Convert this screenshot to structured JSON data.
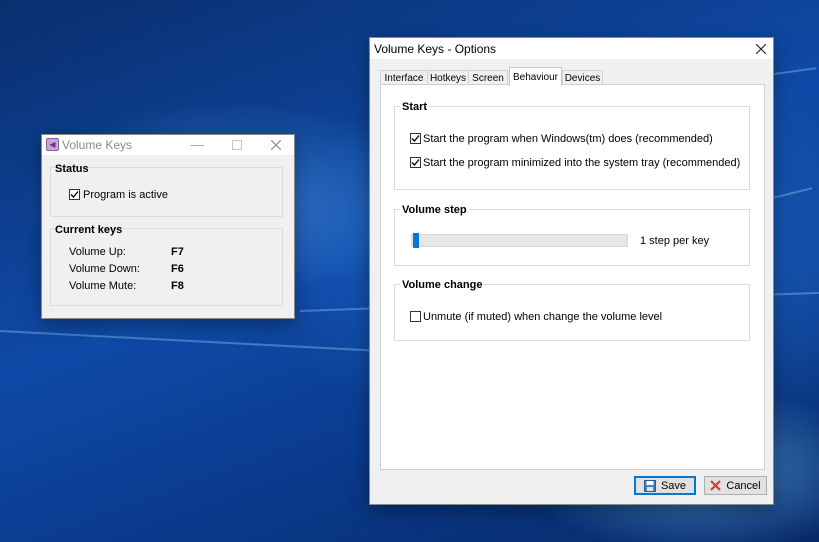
{
  "small_window": {
    "title": "Volume Keys",
    "status_group": "Status",
    "program_active_label": "Program is active",
    "program_active_checked": true,
    "keys_group": "Current keys",
    "keys": [
      {
        "label": "Volume Up:",
        "key": "F7"
      },
      {
        "label": "Volume Down:",
        "key": "F6"
      },
      {
        "label": "Volume Mute:",
        "key": "F8"
      }
    ]
  },
  "options_window": {
    "title": "Volume Keys - Options",
    "tabs": [
      "Interface",
      "Hotkeys",
      "Screen",
      "Behaviour",
      "Devices"
    ],
    "active_tab": "Behaviour",
    "start_group": "Start",
    "start_windows_label": "Start the program when Windows(tm) does (recommended)",
    "start_windows_checked": true,
    "start_minimized_label": "Start the program minimized into the system tray (recommended)",
    "start_minimized_checked": true,
    "step_group": "Volume step",
    "step_label": "1 step per key",
    "step_value_fraction": 0.0,
    "change_group": "Volume change",
    "unmute_label": "Unmute (if muted) when change the volume level",
    "unmute_checked": false,
    "save_label": "Save",
    "cancel_label": "Cancel"
  },
  "icons": {
    "close": "close-icon",
    "minimize": "minimize-icon",
    "maximize": "maximize-icon",
    "save": "floppy-disk-icon",
    "cancel": "cross-icon"
  },
  "colors": {
    "accent": "#0078d7",
    "cancel_icon": "#d83b3b"
  }
}
